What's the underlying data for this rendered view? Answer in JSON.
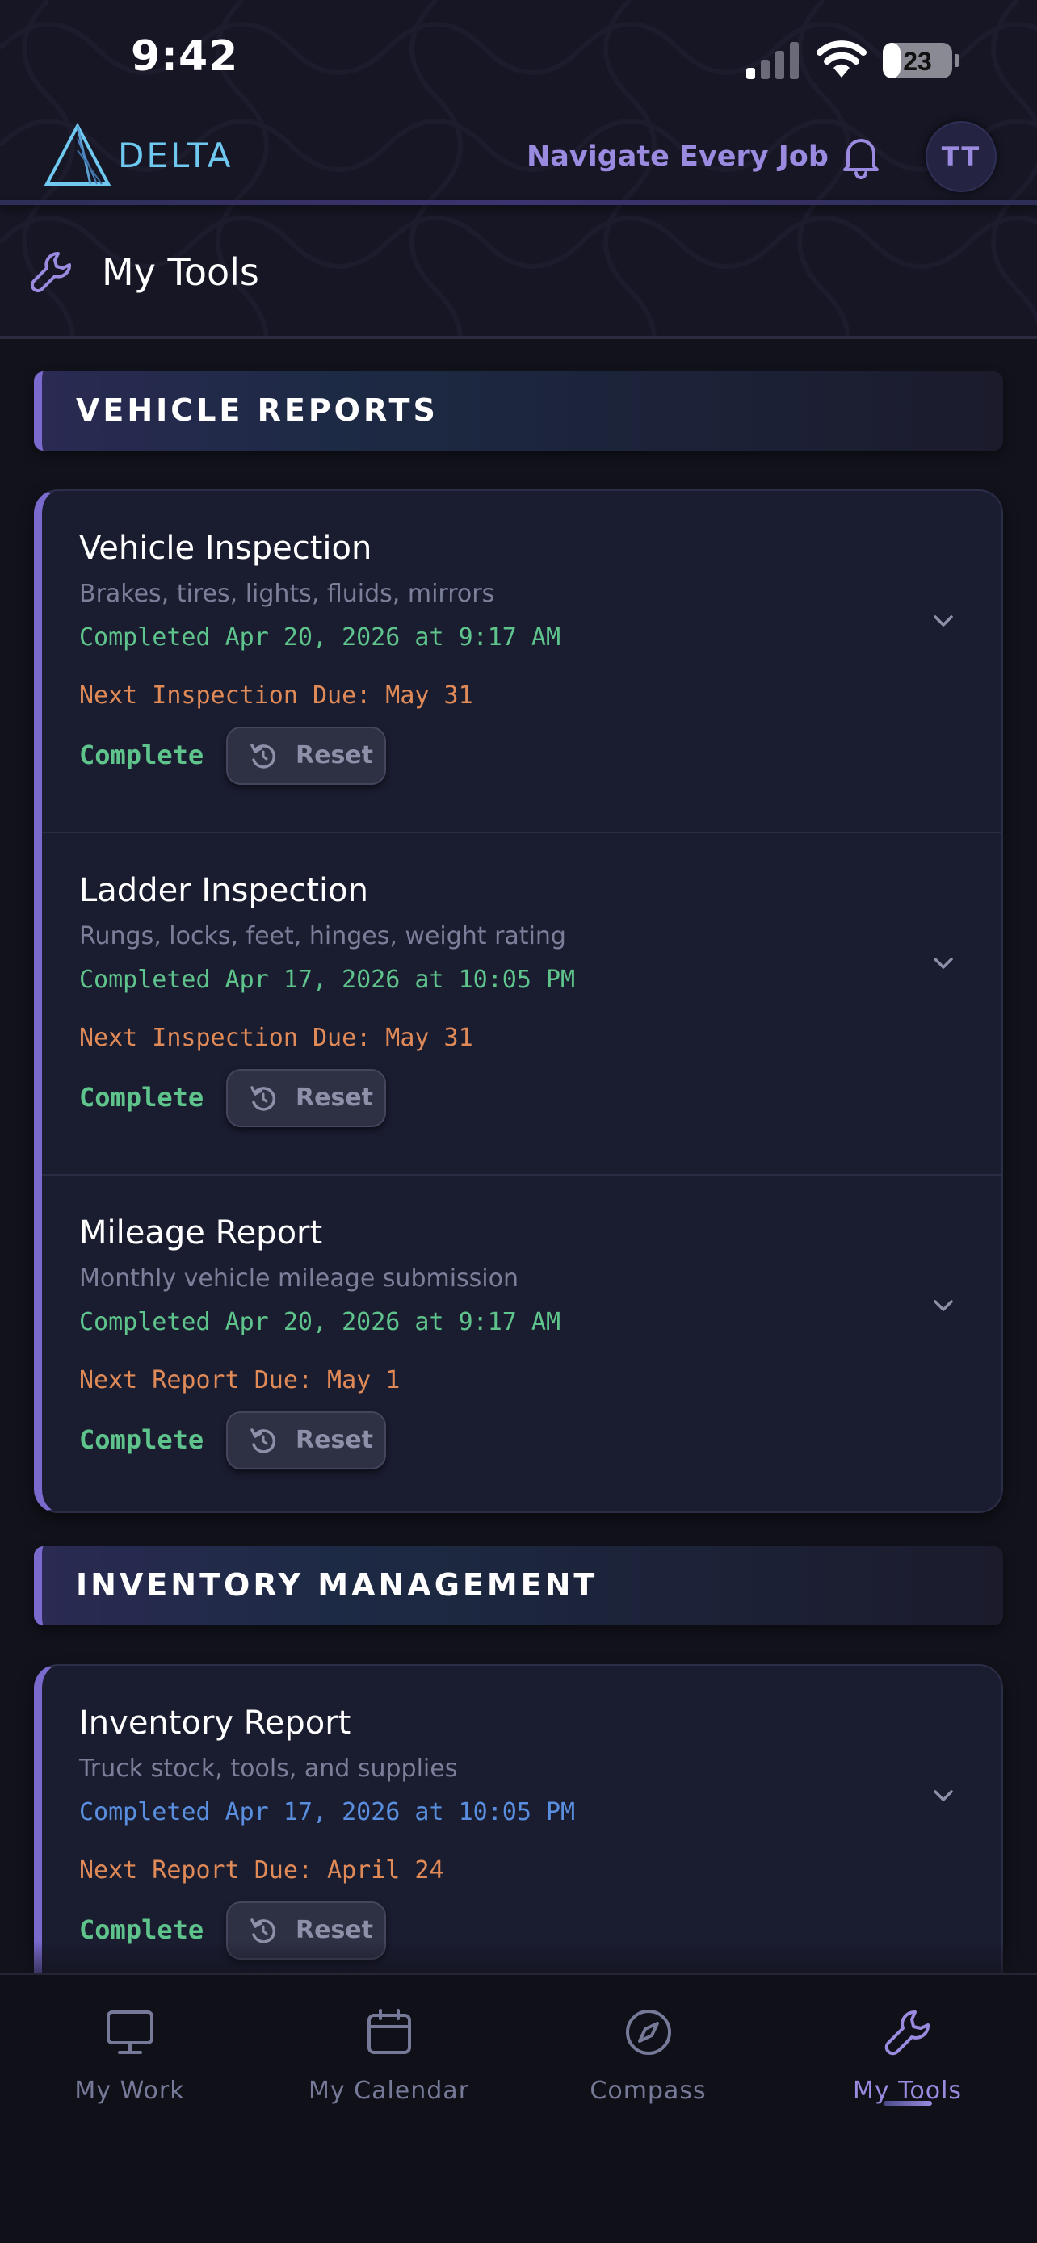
{
  "status_bar": {
    "time": "9:42",
    "battery": "23"
  },
  "app_bar": {
    "brand": "DELTA",
    "tagline": "Navigate Every Job",
    "avatar_initials": "TT",
    "icons": [
      "delta-logo-icon",
      "bell-icon"
    ]
  },
  "page": {
    "title": "My Tools",
    "icon": "wrench-icon"
  },
  "sections": [
    {
      "title": "VEHICLE REPORTS",
      "items": [
        {
          "title": "Vehicle Inspection",
          "description": "Brakes, tires, lights, fluids, mirrors",
          "completed": "Completed Apr 20, 2026 at 9:17 AM",
          "due": "Next Inspection Due: May 31",
          "status": "Complete",
          "reset_label": "Reset"
        },
        {
          "title": "Ladder Inspection",
          "description": "Rungs, locks, feet, hinges, weight rating",
          "completed": "Completed Apr 17, 2026 at 10:05 PM",
          "due": "Next Inspection Due: May 31",
          "status": "Complete",
          "reset_label": "Reset"
        },
        {
          "title": "Mileage Report",
          "description": "Monthly vehicle mileage submission",
          "completed": "Completed Apr 20, 2026 at 9:17 AM",
          "due": "Next Report Due: May 1",
          "status": "Complete",
          "reset_label": "Reset"
        }
      ]
    },
    {
      "title": "INVENTORY MANAGEMENT",
      "items": [
        {
          "title": "Inventory Report",
          "description": "Truck stock, tools, and supplies",
          "completed": "Completed Apr 17, 2026 at 10:05 PM",
          "due": "Next Report Due: April 24",
          "status": "Complete",
          "reset_label": "Reset"
        }
      ]
    }
  ],
  "tabs": [
    {
      "label": "My Work",
      "icon": "monitor-icon"
    },
    {
      "label": "My Calendar",
      "icon": "calendar-icon"
    },
    {
      "label": "Compass",
      "icon": "compass-icon"
    },
    {
      "label": "My Tools",
      "icon": "wrench-icon",
      "active": true
    }
  ],
  "colors": {
    "accent": "#7a6acd",
    "complete_green": "#5ec48c",
    "due_orange": "#e08a58",
    "completed_blue": "#5a8fe0",
    "brand_cyan": "#6fc8f0"
  }
}
